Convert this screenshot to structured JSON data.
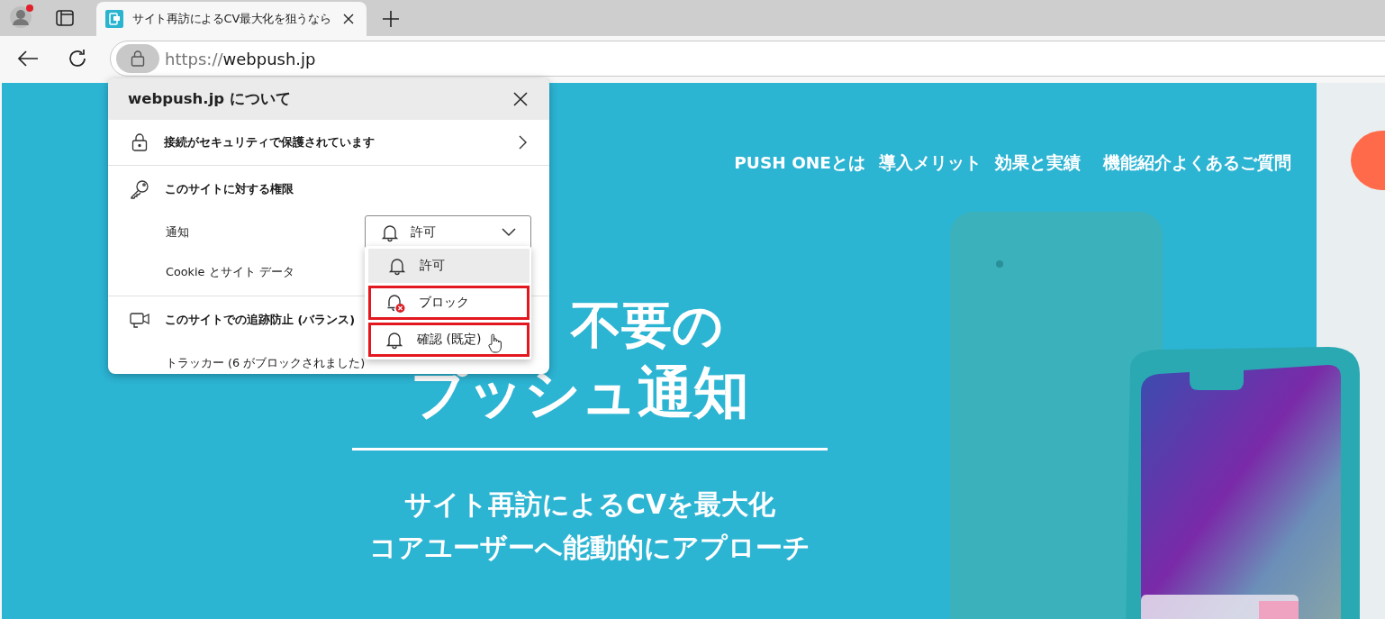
{
  "tabs": [
    {
      "title": "サイト再訪によるCV最大化を狙うなら",
      "selected": true
    }
  ],
  "address_bar": {
    "scheme": "https://",
    "host": "webpush.jp"
  },
  "site_info": {
    "title": "webpush.jp について",
    "connection": "接続がセキュリティで保護されています",
    "permissions_heading": "このサイトに対する権限",
    "permissions": [
      {
        "label": "通知",
        "kind": "dropdown",
        "value": "許可"
      },
      {
        "label": "Cookie とサイト データ",
        "kind": "plain"
      }
    ],
    "dropdown_options": [
      {
        "label": "許可",
        "kind": "allow",
        "selected": true,
        "highlighted": false
      },
      {
        "label": "ブロック",
        "kind": "block",
        "selected": false,
        "highlighted": true
      },
      {
        "label": "確認 (既定)",
        "kind": "ask",
        "selected": false,
        "highlighted": true
      }
    ],
    "tracking_heading": "このサイトでの追跡防止 (バランス)",
    "trackers": "トラッカー (6 がブロックされました)"
  },
  "page": {
    "nav": [
      "PUSH ONEとは",
      "導入メリット",
      "効果と実績",
      "機能紹介",
      "よくあるご質問"
    ],
    "headline": [
      "不要の",
      "プッシュ通知"
    ],
    "subtitle": [
      "サイト再訪によるCVを最大化",
      "コアユーザーへ能動的にアプローチ"
    ]
  }
}
